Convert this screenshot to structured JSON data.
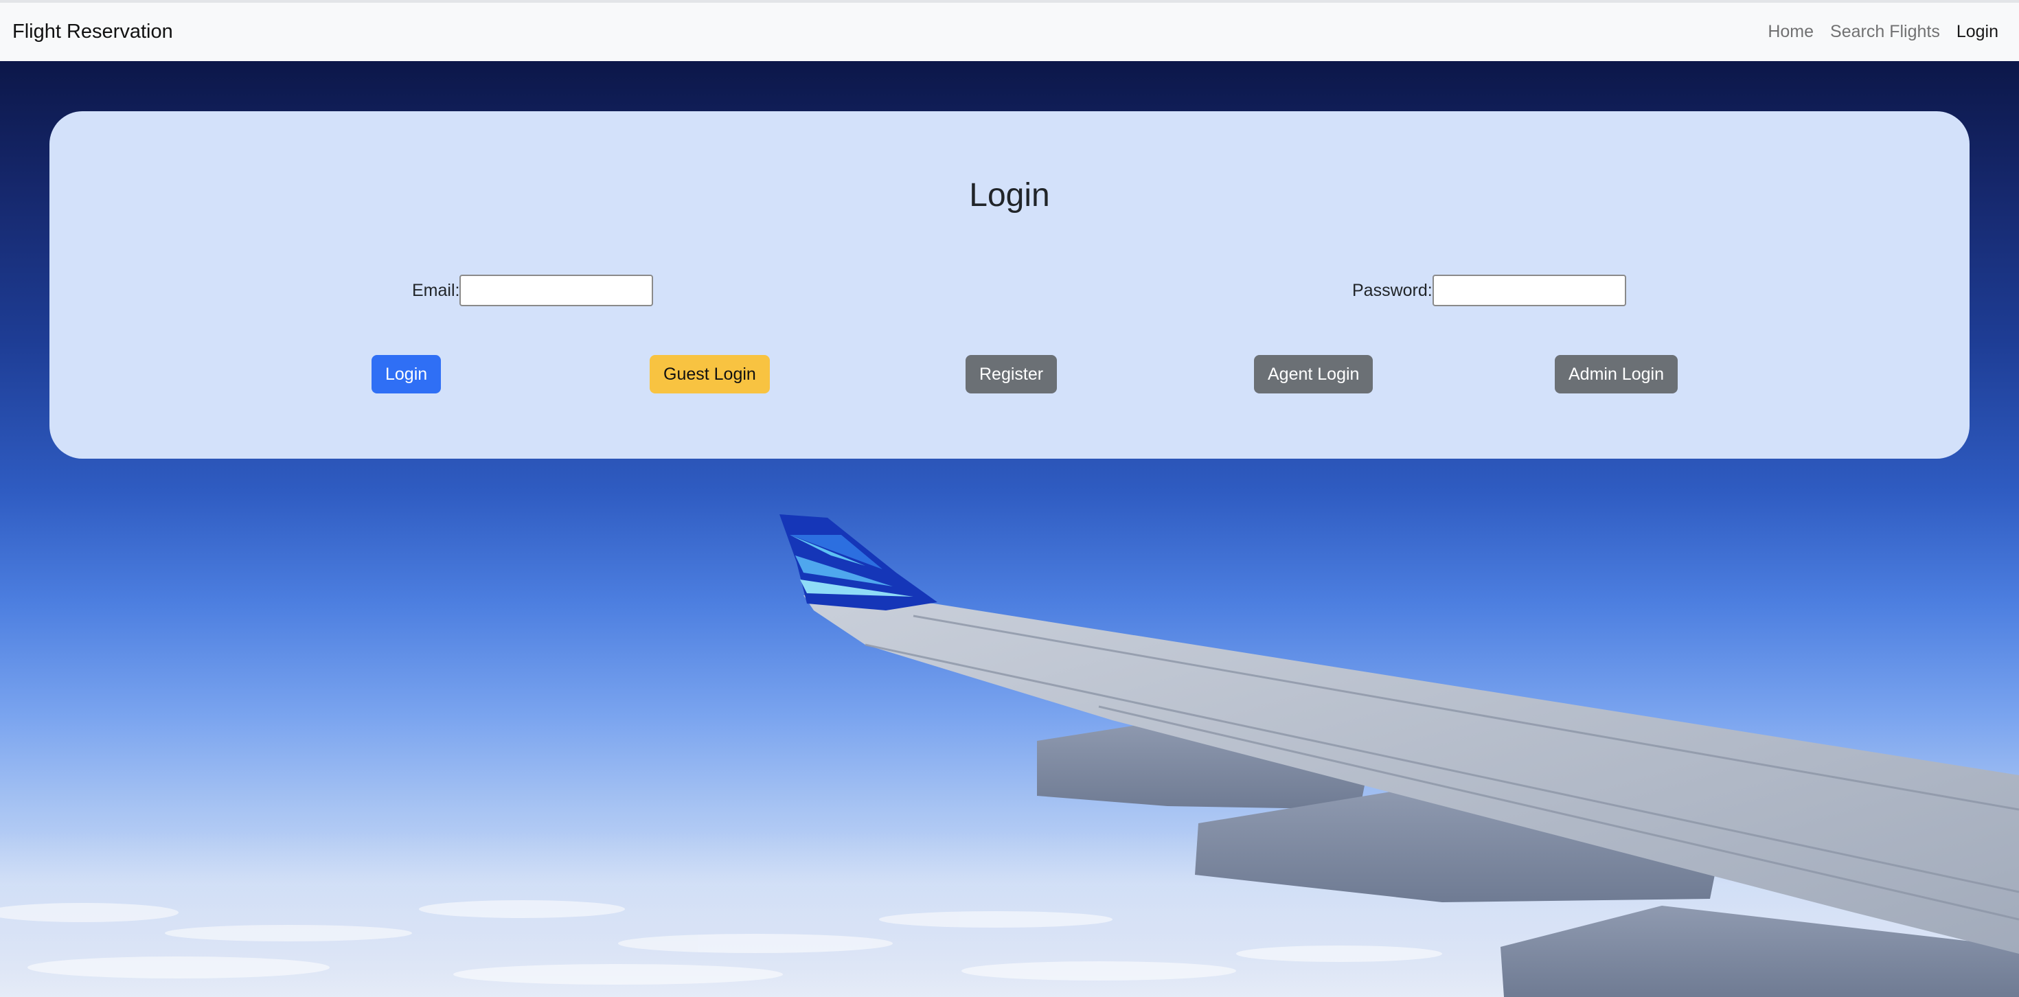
{
  "navbar": {
    "brand": "Flight Reservation",
    "links": [
      "Home",
      "Search Flights",
      "Login"
    ]
  },
  "login": {
    "title": "Login",
    "email_label": "Email:",
    "email_value": "",
    "password_label": "Password:",
    "password_value": "",
    "buttons": {
      "login": "Login",
      "guest_login": "Guest Login",
      "register": "Register",
      "agent_login": "Agent Login",
      "admin_login": "Admin Login"
    }
  },
  "colors": {
    "navbar_bg": "#f8f9fa",
    "card_bg": "#d3e1fa",
    "primary": "#2f6ff5",
    "warning": "#f8c341",
    "secondary": "#6b7075"
  }
}
